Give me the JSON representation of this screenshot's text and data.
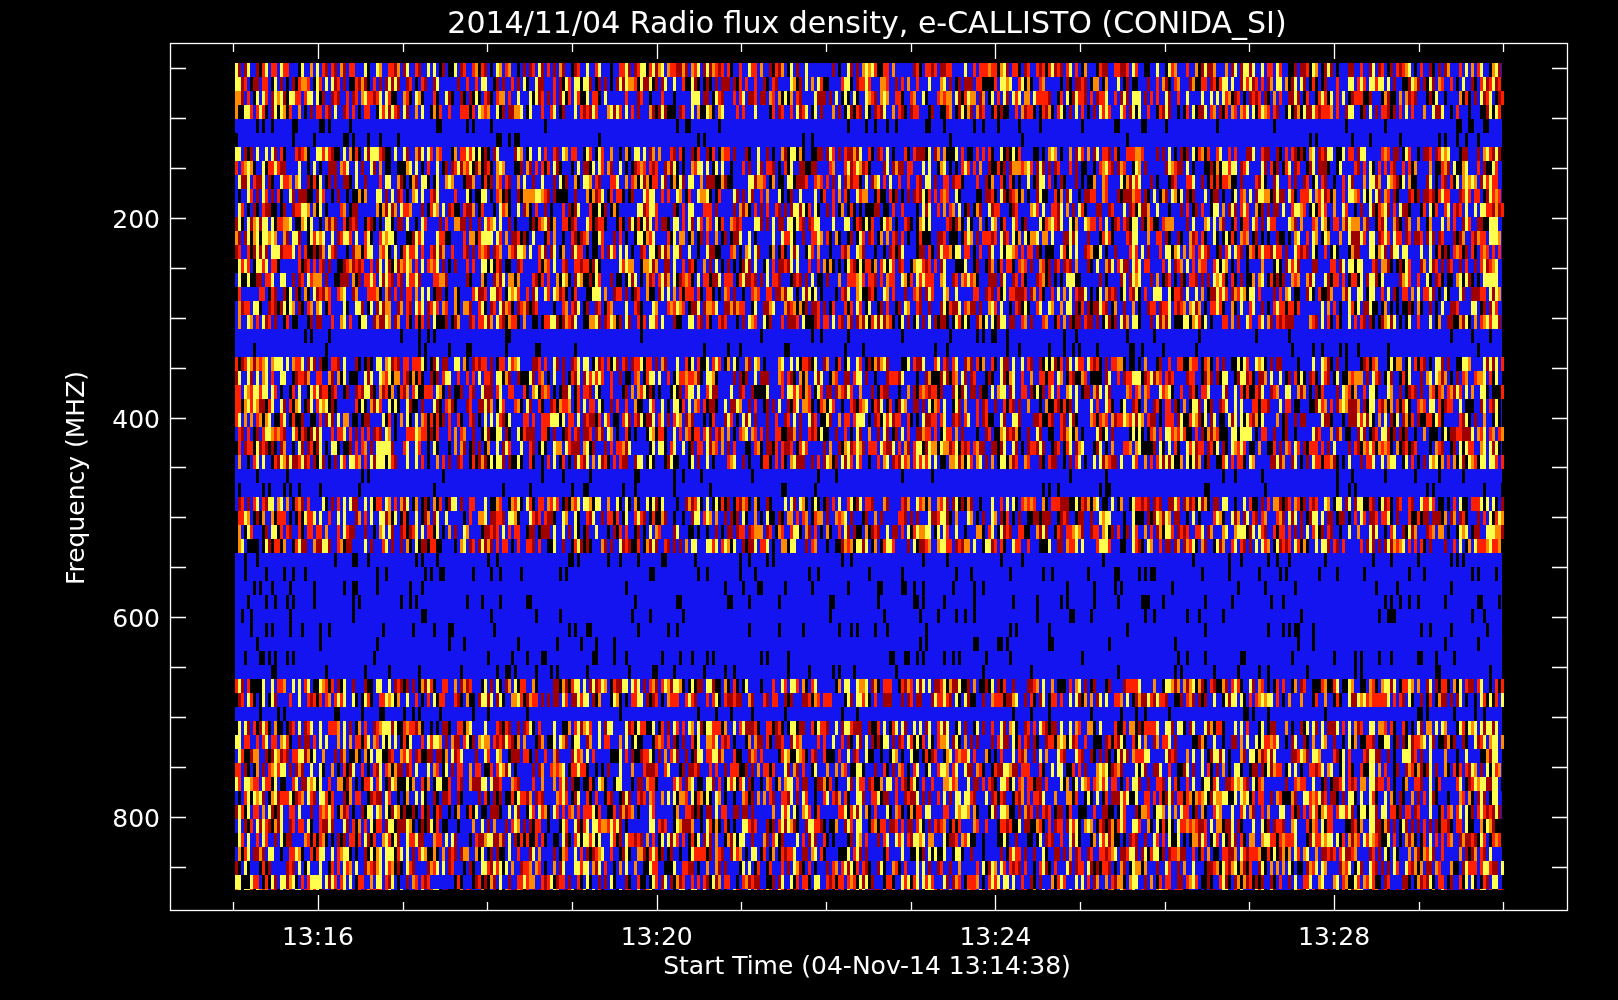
{
  "chart": {
    "title": "2014/11/04  Radio flux density, e-CALLISTO (CONIDA_SI)",
    "ylabel": "Frequency (MHZ)",
    "xlabel": "Start Time (04-Nov-14 13:14:38)",
    "yticks": [
      "200",
      "400",
      "600",
      "800"
    ],
    "xticks": [
      "13:16",
      "13:20",
      "13:24",
      "13:28"
    ]
  }
}
